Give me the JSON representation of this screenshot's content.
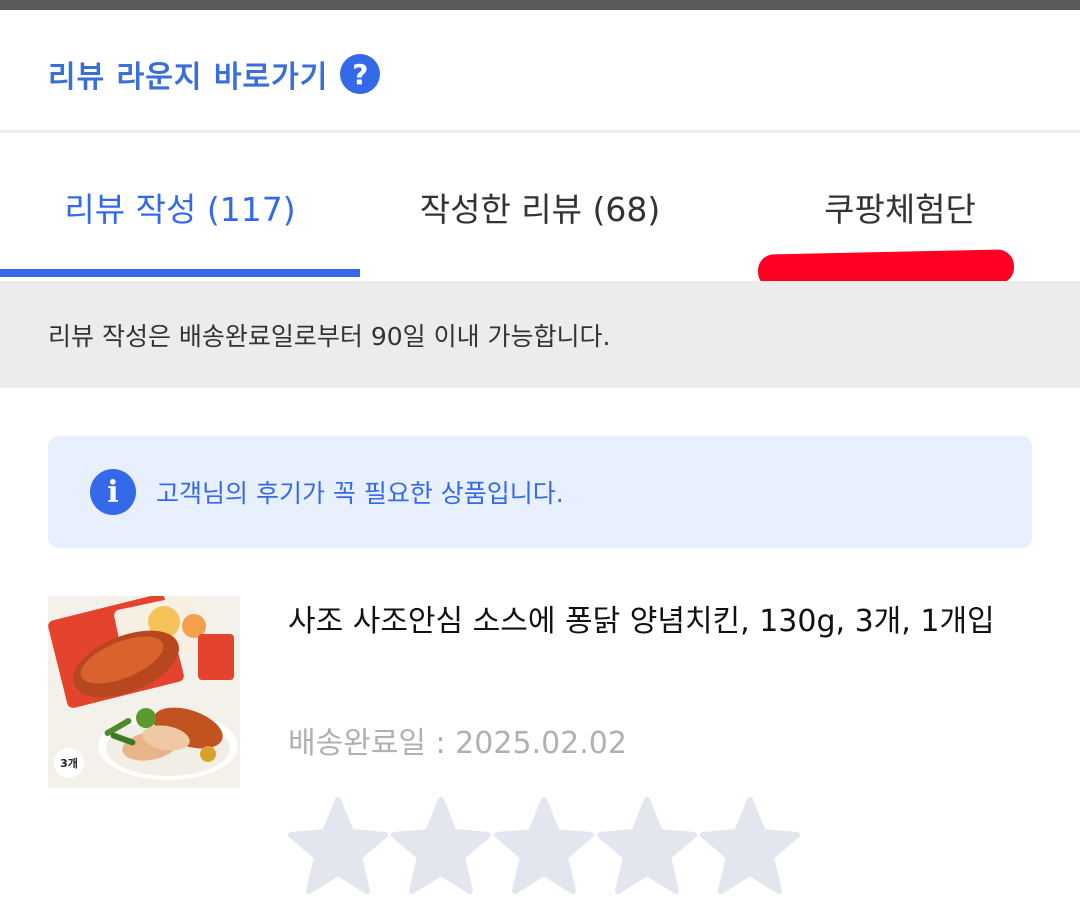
{
  "header": {
    "review_lounge_label": "리뷰 라운지 바로가기",
    "help_icon": "?"
  },
  "tabs": [
    {
      "label": "리뷰 작성 (117)",
      "active": true
    },
    {
      "label": "작성한 리뷰 (68)",
      "active": false
    },
    {
      "label": "쿠팡체험단",
      "active": false
    }
  ],
  "notice": {
    "text": "리뷰 작성은 배송완료일로부터 90일 이내 가능합니다."
  },
  "info_banner": {
    "icon": "i",
    "text": "고객님의 후기가 꼭 필요한 상품입니다."
  },
  "product": {
    "name": "사조 사조안심 소스에 퐁닭 양념치킨, 130g, 3개, 1개입",
    "delivery_label": "배송완료일 : 2025.02.02",
    "quantity_badge": "3개",
    "rating": 0,
    "max_rating": 5
  },
  "colors": {
    "accent": "#346aea",
    "red_annotation": "#ff0022",
    "star_empty": "#e3e6ee"
  }
}
